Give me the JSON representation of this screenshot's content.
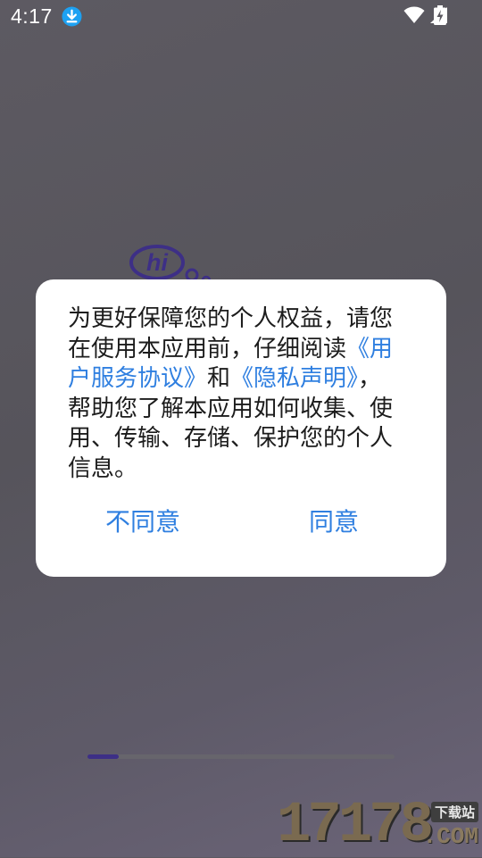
{
  "status_bar": {
    "time": "4:17",
    "icons": [
      "download-icon",
      "wifi-icon",
      "signal-icon",
      "battery-charging-icon"
    ],
    "download_icon_color": "#1da1f2"
  },
  "background": {
    "logo_text": "hi",
    "logo_color": "#3d2f86"
  },
  "dialog": {
    "message_parts": {
      "p1": "为更好保障您的个人权益，请您在使用本应用前，仔细阅读",
      "link1": "《用户服务协议》",
      "p2": "和",
      "link2": "《隐私声明》",
      "p3": "，帮助您了解本应用如何收集、使用、传输、存储、保护您的个人信息。"
    },
    "disagree_label": "不同意",
    "agree_label": "同意",
    "link_color": "#2f7fe0"
  },
  "pager": {
    "total_pages": 10,
    "current_page": 1,
    "active_color": "#3d2f86"
  },
  "watermark": {
    "digits": "17178",
    "tag": "下载站",
    "domain": ".COM"
  }
}
